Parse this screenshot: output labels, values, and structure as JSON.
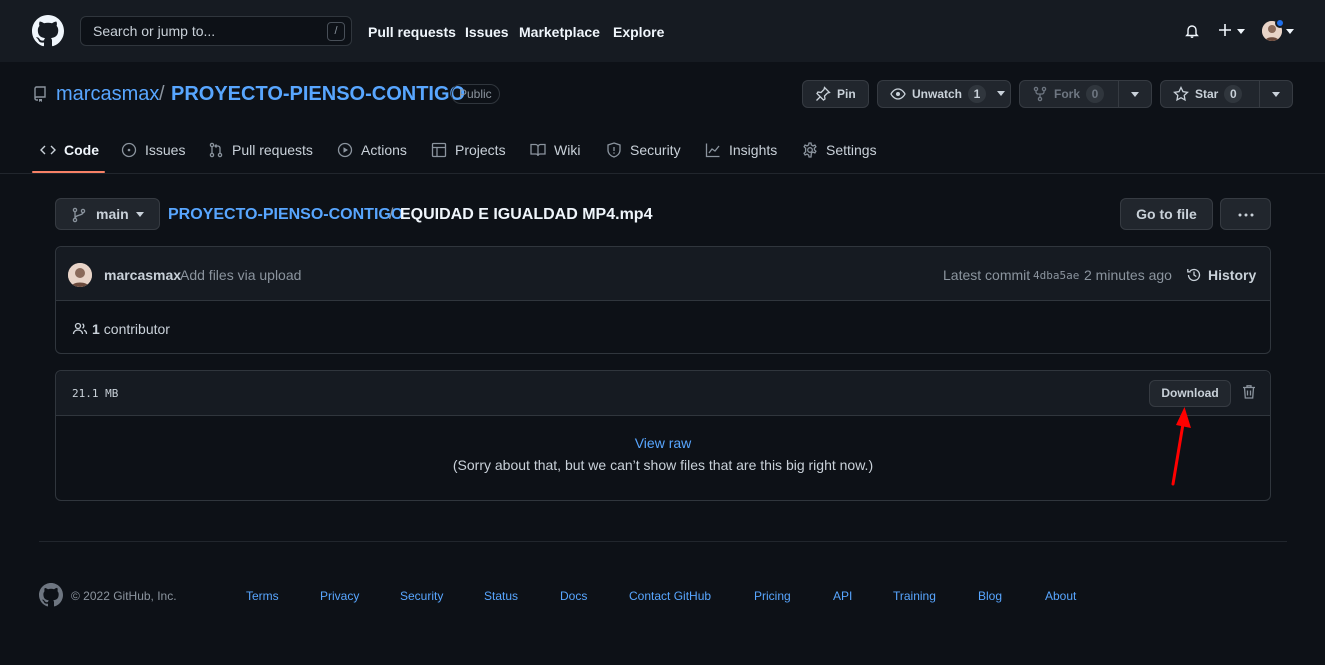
{
  "header": {
    "search_placeholder": "Search or jump to...",
    "search_shortcut": "/",
    "nav": [
      "Pull requests",
      "Issues",
      "Marketplace",
      "Explore"
    ]
  },
  "repo": {
    "owner": "marcasmax",
    "separator": "/",
    "name": "PROYECTO-PIENSO-CONTIGO",
    "visibility": "Public",
    "pin_label": "Pin",
    "unwatch_label": "Unwatch",
    "watch_count": "1",
    "fork_label": "Fork",
    "fork_count": "0",
    "star_label": "Star",
    "star_count": "0"
  },
  "tabs": [
    {
      "label": "Code",
      "icon": "code-icon"
    },
    {
      "label": "Issues",
      "icon": "issue-icon"
    },
    {
      "label": "Pull requests",
      "icon": "pull-request-icon"
    },
    {
      "label": "Actions",
      "icon": "play-icon"
    },
    {
      "label": "Projects",
      "icon": "table-icon"
    },
    {
      "label": "Wiki",
      "icon": "book-icon"
    },
    {
      "label": "Security",
      "icon": "shield-icon"
    },
    {
      "label": "Insights",
      "icon": "graph-icon"
    },
    {
      "label": "Settings",
      "icon": "gear-icon"
    }
  ],
  "file_nav": {
    "branch": "main",
    "repo_crumb": "PROYECTO-PIENSO-CONTIGO",
    "crumb_sep": "/",
    "file_name": "EQUIDAD E IGUALDAD MP4.mp4",
    "goto_file_label": "Go to file"
  },
  "commit": {
    "author": "marcasmax",
    "message": "Add files via upload",
    "latest_label": "Latest commit",
    "sha": "4dba5ae",
    "time_ago": "2 minutes ago",
    "history_label": "History",
    "contributors_count": "1",
    "contributors_label": "contributor"
  },
  "file": {
    "size": "21.1 MB",
    "download_label": "Download",
    "view_raw_label": "View raw",
    "too_big_message": "(Sorry about that, but we can’t show files that are this big right now.)"
  },
  "footer": {
    "copyright": "© 2022 GitHub, Inc.",
    "links": [
      "Terms",
      "Privacy",
      "Security",
      "Status",
      "Docs",
      "Contact GitHub",
      "Pricing",
      "API",
      "Training",
      "Blog",
      "About"
    ]
  },
  "colors": {
    "background": "#0d1117",
    "header": "#161b22",
    "link": "#58a6ff",
    "active_tab_underline": "#f78166",
    "annotation_arrow": "#ff0000"
  }
}
